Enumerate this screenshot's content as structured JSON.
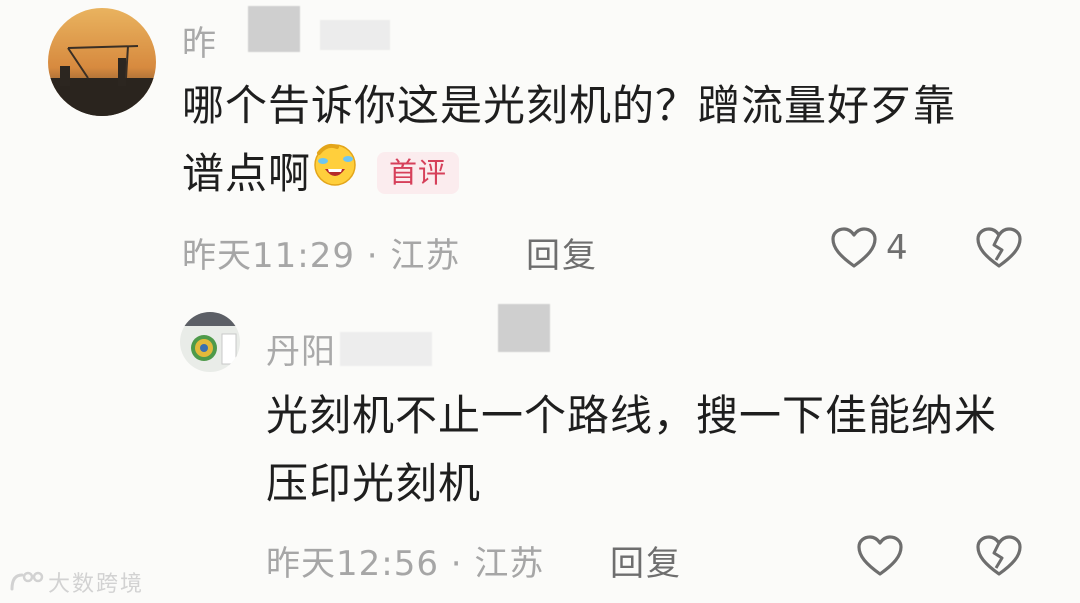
{
  "comments": [
    {
      "username": "昨",
      "text_line1": "哪个告诉你这是光刻机的？蹭流量好歹靠",
      "text_line2": "谱点啊",
      "emoji": "laughing-crying-emoji",
      "badge": "首评",
      "time_location": "昨天11:29 · 江苏",
      "reply_label": "回复",
      "like_count": "4"
    },
    {
      "username": "丹阳",
      "text_line1": "光刻机不止一个路线，搜一下佳能纳米",
      "text_line2": "压印光刻机",
      "time_location": "昨天12:56 · 江苏",
      "reply_label": "回复"
    }
  ],
  "watermark": "大数跨境",
  "colors": {
    "meta_gray": "#a6a6a6",
    "badge_red": "#d6405a",
    "badge_bg": "#fbecee",
    "icon_gray": "#6e6e6e"
  }
}
